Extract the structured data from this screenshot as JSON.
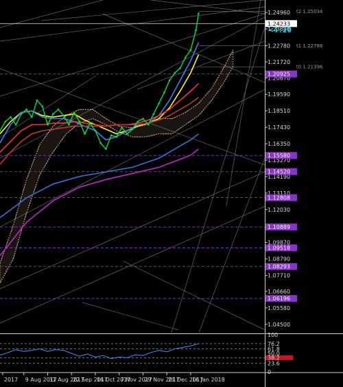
{
  "chart_data": {
    "type": "line",
    "title": "",
    "price_axis": {
      "ylim": [
        1.0395,
        1.256
      ],
      "ticks": [
        "1.24960",
        "1.23880",
        "1.22780",
        "1.21720",
        "1.20670",
        "1.19590",
        "1.18510",
        "1.17430",
        "1.16350",
        "1.15270",
        "1.14190",
        "1.13110",
        "1.12030",
        "1.10950",
        "1.09870",
        "1.08790",
        "1.07710",
        "1.06660",
        "1.05580",
        "1.04500"
      ]
    },
    "price_highlights": [
      {
        "label": "1.24233",
        "value": 1.24233,
        "bg": "#ffffff",
        "fg": "#000000"
      },
      {
        "label": "1.20925",
        "value": 1.20925,
        "bg": "#8a33c8",
        "fg": "#ffffff"
      },
      {
        "label": "1.15580",
        "value": 1.1558,
        "bg": "#8a33c8",
        "fg": "#ffffff"
      },
      {
        "label": "1.14520",
        "value": 1.1452,
        "bg": "#8a33c8",
        "fg": "#ffffff"
      },
      {
        "label": "1.12808",
        "value": 1.12808,
        "bg": "#8a33c8",
        "fg": "#ffffff"
      },
      {
        "label": "1.10889",
        "value": 1.10889,
        "bg": "#8a33c8",
        "fg": "#ffffff"
      },
      {
        "label": "1.09518",
        "value": 1.09518,
        "bg": "#8a33c8",
        "fg": "#ffffff"
      },
      {
        "label": "1.08293",
        "value": 1.08293,
        "bg": "#8a33c8",
        "fg": "#ffffff"
      },
      {
        "label": "1.06196",
        "value": 1.06196,
        "bg": "#8a33c8",
        "fg": "#ffffff"
      }
    ],
    "level_labels": [
      {
        "text": "t2 1.25034",
        "value": 1.25034
      },
      {
        "text": "t1 1.22788",
        "value": 1.22788
      },
      {
        "text": "t0 1.21396",
        "value": 1.21396
      }
    ],
    "dashed_levels": [
      1.20925,
      1.1558,
      1.1452,
      1.12808,
      1.10889,
      1.09518,
      1.08293,
      1.06196
    ],
    "current_price": 1.24233,
    "countdown": "<4:20",
    "x_axis": {
      "xlim": [
        0,
        100
      ],
      "date_labels": [
        {
          "text": "2017",
          "x": 1
        },
        {
          "text": "9 Aug 2017",
          "x": 9
        },
        {
          "text": "31 Aug 2017",
          "x": 18
        },
        {
          "text": "22 Sep 2017",
          "x": 27
        },
        {
          "text": "16 Oct 2017",
          "x": 36
        },
        {
          "text": "7 Nov 2017",
          "x": 45
        },
        {
          "text": "29 Nov 2017",
          "x": 54
        },
        {
          "text": "21 Dec 2017",
          "x": 63
        },
        {
          "text": "16 Jan 2018",
          "x": 72
        }
      ]
    },
    "close_series": {
      "color": "#00e040",
      "x": [
        0,
        2,
        4,
        6,
        8,
        10,
        12,
        14,
        16,
        18,
        20,
        22,
        24,
        26,
        28,
        30,
        32,
        34,
        36,
        38,
        40,
        42,
        44,
        46,
        48,
        50,
        52,
        54,
        56,
        58,
        60,
        62,
        64,
        66,
        68,
        70,
        72,
        74,
        75
      ],
      "y": [
        1.172,
        1.178,
        1.181,
        1.176,
        1.183,
        1.186,
        1.181,
        1.192,
        1.188,
        1.176,
        1.183,
        1.186,
        1.182,
        1.176,
        1.184,
        1.178,
        1.17,
        1.177,
        1.172,
        1.164,
        1.16,
        1.169,
        1.168,
        1.174,
        1.17,
        1.173,
        1.178,
        1.18,
        1.176,
        1.183,
        1.19,
        1.197,
        1.205,
        1.21,
        1.213,
        1.22,
        1.225,
        1.238,
        1.249
      ]
    },
    "series": [
      {
        "color": "#ffff00",
        "x": [
          0,
          4,
          8,
          12,
          16,
          20,
          24,
          28,
          32,
          36,
          40,
          44,
          48,
          52,
          56,
          60,
          64,
          68,
          72,
          75
        ],
        "y": [
          1.17,
          1.178,
          1.184,
          1.185,
          1.182,
          1.181,
          1.182,
          1.183,
          1.179,
          1.176,
          1.173,
          1.17,
          1.172,
          1.175,
          1.177,
          1.18,
          1.187,
          1.198,
          1.21,
          1.222
        ]
      },
      {
        "color": "#3b82f6",
        "x": [
          0,
          4,
          8,
          12,
          16,
          20,
          24,
          28,
          32,
          36,
          40,
          44,
          48,
          52,
          56,
          60,
          64,
          68,
          72,
          75
        ],
        "y": [
          1.164,
          1.176,
          1.184,
          1.185,
          1.181,
          1.18,
          1.18,
          1.178,
          1.175,
          1.172,
          1.166,
          1.168,
          1.172,
          1.176,
          1.177,
          1.182,
          1.192,
          1.205,
          1.218,
          1.23
        ]
      },
      {
        "color": "#ff3030",
        "x": [
          0,
          4,
          8,
          12,
          16,
          20,
          24,
          28,
          32,
          36,
          40,
          44,
          48,
          52,
          56,
          60,
          64,
          68,
          72,
          75
        ],
        "y": [
          1.158,
          1.165,
          1.172,
          1.176,
          1.176,
          1.177,
          1.177,
          1.178,
          1.177,
          1.176,
          1.175,
          1.176,
          1.176,
          1.177,
          1.179,
          1.182,
          1.186,
          1.192,
          1.198,
          1.203
        ]
      },
      {
        "color": "#c0392b",
        "x": [
          0,
          4,
          8,
          12,
          16,
          20,
          24,
          28,
          32,
          36,
          40,
          44,
          48,
          52,
          56,
          60,
          64,
          68,
          72,
          75
        ],
        "y": [
          1.15,
          1.158,
          1.165,
          1.17,
          1.172,
          1.173,
          1.174,
          1.175,
          1.175,
          1.175,
          1.175,
          1.176,
          1.176,
          1.176,
          1.177,
          1.179,
          1.182,
          1.186,
          1.19,
          1.194
        ]
      },
      {
        "color": "#3a6fd8",
        "x": [
          0,
          10,
          20,
          30,
          40,
          50,
          60,
          66,
          72,
          75
        ],
        "y": [
          1.115,
          1.128,
          1.137,
          1.142,
          1.145,
          1.148,
          1.154,
          1.16,
          1.166,
          1.17
        ]
      },
      {
        "color": "#c026d3",
        "x": [
          0,
          10,
          20,
          30,
          40,
          50,
          60,
          66,
          72,
          75
        ],
        "y": [
          1.09,
          1.112,
          1.126,
          1.135,
          1.14,
          1.144,
          1.148,
          1.152,
          1.156,
          1.16
        ]
      }
    ],
    "kumo": {
      "color": "#f4c89a",
      "x": [
        0,
        5,
        10,
        15,
        20,
        25,
        30,
        35,
        40,
        45,
        50,
        55,
        60,
        65,
        70,
        75,
        80,
        85,
        88
      ],
      "y1": [
        1.085,
        1.11,
        1.14,
        1.163,
        1.175,
        1.182,
        1.186,
        1.186,
        1.18,
        1.175,
        1.174,
        1.176,
        1.18,
        1.18,
        1.184,
        1.19,
        1.2,
        1.215,
        1.225
      ],
      "y2": [
        1.072,
        1.088,
        1.118,
        1.143,
        1.158,
        1.17,
        1.177,
        1.18,
        1.176,
        1.171,
        1.168,
        1.168,
        1.17,
        1.17,
        1.176,
        1.182,
        1.192,
        1.205,
        1.214
      ]
    },
    "oscillator": {
      "ylim": [
        0,
        100
      ],
      "ticks": [
        "100",
        "76.2",
        "61.8",
        "50.0",
        "38.2",
        "23.6",
        "0"
      ],
      "levels": [
        76.2,
        61.8,
        38.2,
        23.6
      ],
      "color": "#3b82f6",
      "x": [
        0,
        3,
        6,
        9,
        12,
        15,
        18,
        21,
        24,
        27,
        30,
        33,
        36,
        39,
        42,
        45,
        48,
        51,
        54,
        57,
        60,
        63,
        66,
        69,
        72,
        75
      ],
      "y": [
        45,
        52,
        60,
        55,
        58,
        62,
        55,
        60,
        58,
        50,
        42,
        48,
        40,
        44,
        36,
        40,
        38,
        46,
        44,
        52,
        58,
        54,
        62,
        66,
        70,
        76
      ]
    }
  }
}
